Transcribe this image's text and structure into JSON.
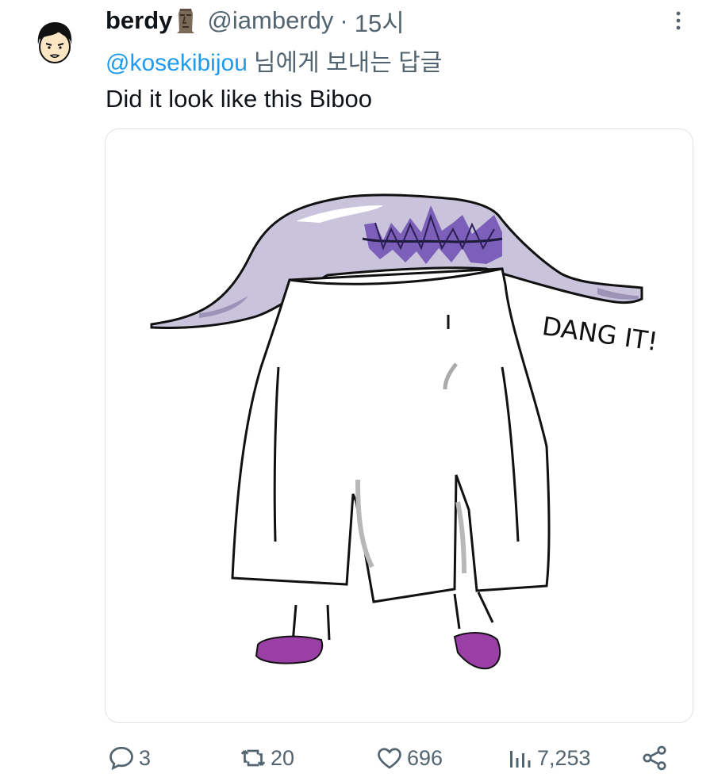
{
  "author": {
    "name": "berdy",
    "handle": "@iamberdy",
    "separator": "·",
    "time": "15시",
    "avatar_icon": "cartoon-face-avatar",
    "name_emoji_icon": "moai-icon"
  },
  "reply_context": {
    "mention": "@kosekibijou",
    "suffix": "님에게 보내는 답글"
  },
  "tweet": {
    "text": "Did it look like this Biboo"
  },
  "media": {
    "drawing_text": "DANG IT!"
  },
  "actions": {
    "reply_count": "3",
    "retweet_count": "20",
    "like_count": "696",
    "view_count": "7,253"
  },
  "colors": {
    "link": "#1d9bf0",
    "secondary_text": "#536471",
    "hat_lavender": "#c9c3dc",
    "hat_purple": "#7b5fb8",
    "shoe_purple": "#9a3fa5"
  }
}
